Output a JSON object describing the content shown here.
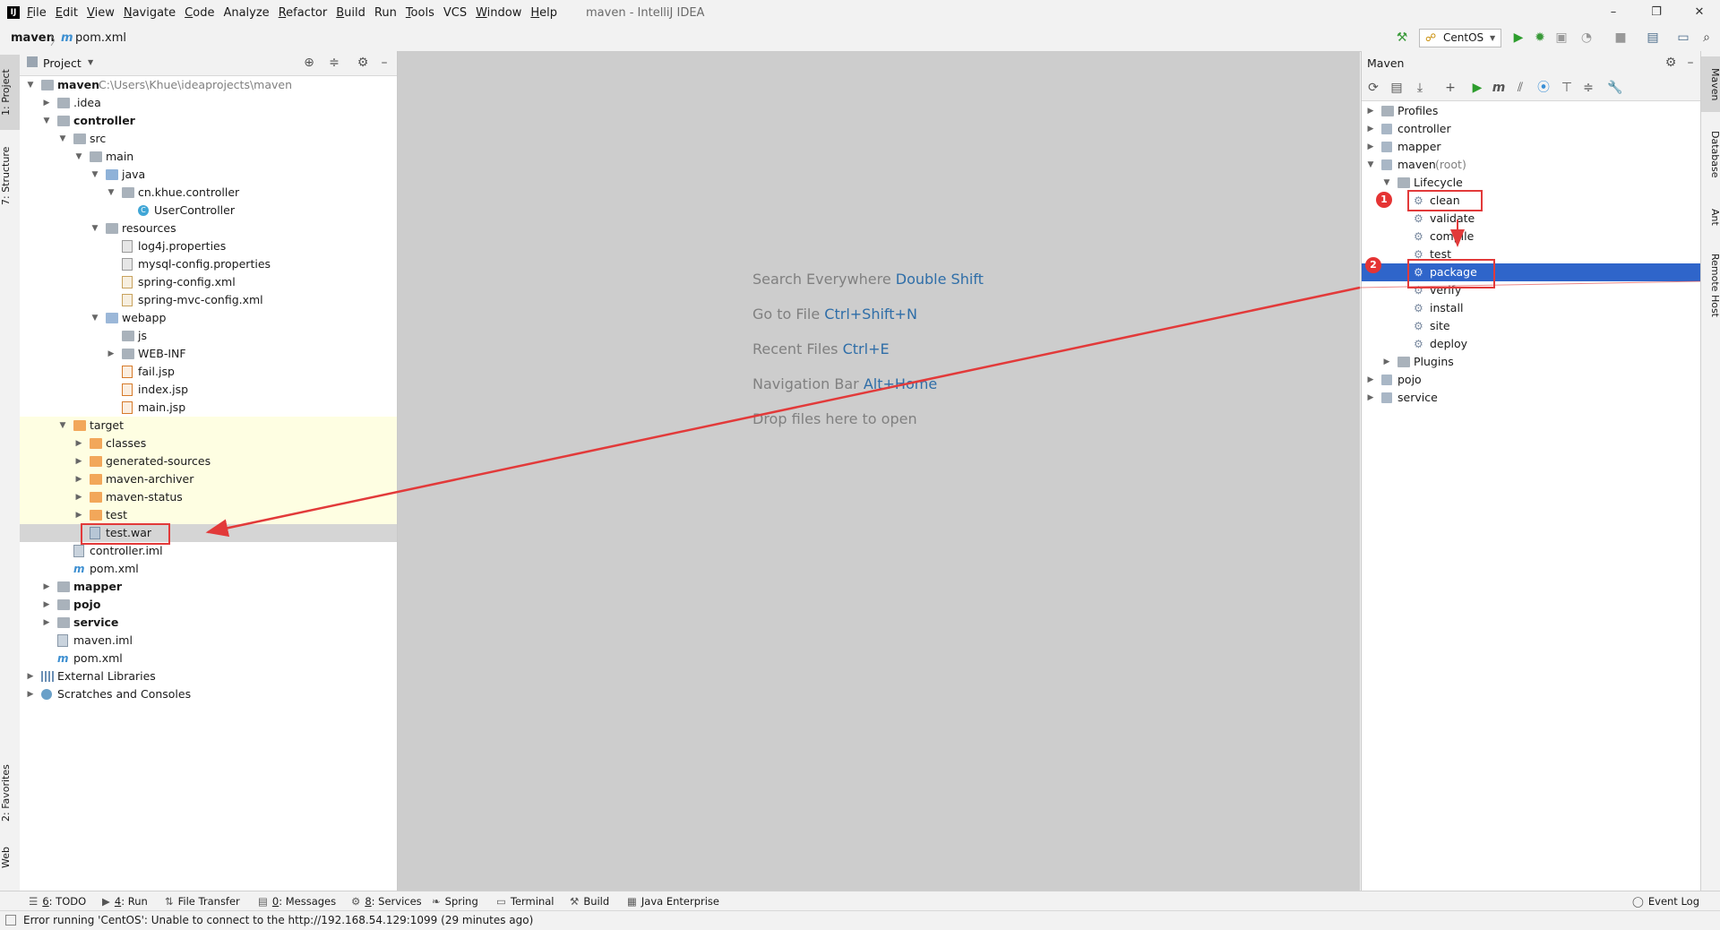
{
  "menubar": {
    "items": [
      {
        "label": "File",
        "u": "F",
        "rest": "ile"
      },
      {
        "label": "Edit",
        "u": "E",
        "rest": "dit"
      },
      {
        "label": "View",
        "u": "V",
        "rest": "iew"
      },
      {
        "label": "Navigate",
        "u": "N",
        "rest": "avigate"
      },
      {
        "label": "Code",
        "u": "C",
        "rest": "ode"
      },
      {
        "label": "Analyze",
        "u": "",
        "rest": "Analyze"
      },
      {
        "label": "Refactor",
        "u": "R",
        "rest": "efactor"
      },
      {
        "label": "Build",
        "u": "B",
        "rest": "uild"
      },
      {
        "label": "Run",
        "u": "",
        "rest": "Run"
      },
      {
        "label": "Tools",
        "u": "T",
        "rest": "ools"
      },
      {
        "label": "VCS",
        "u": "",
        "rest": "VCS"
      },
      {
        "label": "Window",
        "u": "W",
        "rest": "indow"
      },
      {
        "label": "Help",
        "u": "H",
        "rest": "elp"
      }
    ],
    "window_title": "maven - IntelliJ IDEA",
    "minimize": "–",
    "maximize": "❐",
    "close": "✕"
  },
  "navbar": {
    "project": "maven",
    "file_icon": "m",
    "file": "pom.xml",
    "run_config": "CentOS"
  },
  "left_strip": {
    "project": "1: Project",
    "structure": "7: Structure",
    "favorites": "2: Favorites",
    "web": "Web"
  },
  "right_strip": {
    "maven": "Maven",
    "database": "Database",
    "ant": "Ant",
    "remote_host": "Remote Host"
  },
  "project_panel": {
    "title": "Project",
    "rows": [
      {
        "label": "maven",
        "extra": "C:\\Users\\Khue\\ideaprojects\\maven",
        "bold": true,
        "icon": "folder"
      },
      {
        "label": ".idea",
        "icon": "folder"
      },
      {
        "label": "controller",
        "bold": true,
        "icon": "folder"
      },
      {
        "label": "src",
        "icon": "folder"
      },
      {
        "label": "main",
        "icon": "folder"
      },
      {
        "label": "java",
        "icon": "folder-blue"
      },
      {
        "label": "cn.khue.controller",
        "icon": "folder"
      },
      {
        "label": "UserController",
        "icon": "class"
      },
      {
        "label": "resources",
        "icon": "folder"
      },
      {
        "label": "log4j.properties",
        "icon": "properties"
      },
      {
        "label": "mysql-config.properties",
        "icon": "properties"
      },
      {
        "label": "spring-config.xml",
        "icon": "xml"
      },
      {
        "label": "spring-mvc-config.xml",
        "icon": "xml"
      },
      {
        "label": "webapp",
        "icon": "folder-src"
      },
      {
        "label": "js",
        "icon": "folder"
      },
      {
        "label": "WEB-INF",
        "icon": "folder"
      },
      {
        "label": "fail.jsp",
        "icon": "jsp"
      },
      {
        "label": "index.jsp",
        "icon": "jsp"
      },
      {
        "label": "main.jsp",
        "icon": "jsp"
      },
      {
        "label": "target",
        "icon": "folder-orange"
      },
      {
        "label": "classes",
        "icon": "folder-orange"
      },
      {
        "label": "generated-sources",
        "icon": "folder-orange"
      },
      {
        "label": "maven-archiver",
        "icon": "folder-orange"
      },
      {
        "label": "maven-status",
        "icon": "folder-orange"
      },
      {
        "label": "test",
        "icon": "folder-orange"
      },
      {
        "label": "test.war",
        "icon": "war"
      },
      {
        "label": "controller.iml",
        "icon": "iml"
      },
      {
        "label": "pom.xml",
        "icon": "maven"
      },
      {
        "label": "mapper",
        "bold": true,
        "icon": "folder"
      },
      {
        "label": "pojo",
        "bold": true,
        "icon": "folder"
      },
      {
        "label": "service",
        "bold": true,
        "icon": "folder"
      },
      {
        "label": "maven.iml",
        "icon": "iml"
      },
      {
        "label": "pom.xml",
        "icon": "maven"
      },
      {
        "label": "External Libraries",
        "icon": "library"
      },
      {
        "label": "Scratches and Consoles",
        "icon": "scratch"
      }
    ]
  },
  "editor": {
    "hints": [
      {
        "text": "Search Everywhere",
        "key": "Double Shift"
      },
      {
        "text": "Go to File",
        "key": "Ctrl+Shift+N"
      },
      {
        "text": "Recent Files",
        "key": "Ctrl+E"
      },
      {
        "text": "Navigation Bar",
        "key": "Alt+Home"
      },
      {
        "text": "Drop files here to open",
        "key": ""
      }
    ]
  },
  "maven_panel": {
    "title": "Maven",
    "rows": [
      {
        "label": "Profiles"
      },
      {
        "label": "controller"
      },
      {
        "label": "mapper"
      },
      {
        "label": "maven",
        "extra": "(root)"
      },
      {
        "label": "Lifecycle"
      },
      {
        "label": "clean"
      },
      {
        "label": "validate"
      },
      {
        "label": "compile"
      },
      {
        "label": "test"
      },
      {
        "label": "package",
        "selected": true
      },
      {
        "label": "verify"
      },
      {
        "label": "install"
      },
      {
        "label": "site"
      },
      {
        "label": "deploy"
      },
      {
        "label": "Plugins"
      },
      {
        "label": "pojo"
      },
      {
        "label": "service"
      }
    ]
  },
  "annotations": {
    "badge1": "1",
    "badge2": "2",
    "color": "#e23a3a"
  },
  "bottom_bar": {
    "items": [
      {
        "u": "6",
        "rest": ": TODO"
      },
      {
        "u": "4",
        "rest": ": Run"
      },
      {
        "u": "",
        "rest": "File Transfer"
      },
      {
        "u": "0",
        "rest": ": Messages"
      },
      {
        "u": "8",
        "rest": ": Services"
      },
      {
        "u": "",
        "rest": "Spring"
      },
      {
        "u": "",
        "rest": "Terminal"
      },
      {
        "u": "",
        "rest": "Build"
      },
      {
        "u": "",
        "rest": "Java Enterprise"
      }
    ],
    "event_log": "Event Log"
  },
  "status": {
    "message": "Error running 'CentOS': Unable to connect to the http://192.168.54.129:1099 (29 minutes ago)"
  },
  "colors": {
    "selection": "#2f65ca",
    "editor_bg": "#cdcdcd",
    "target_highlight": "#fefee2",
    "link": "#2f6ea8"
  }
}
